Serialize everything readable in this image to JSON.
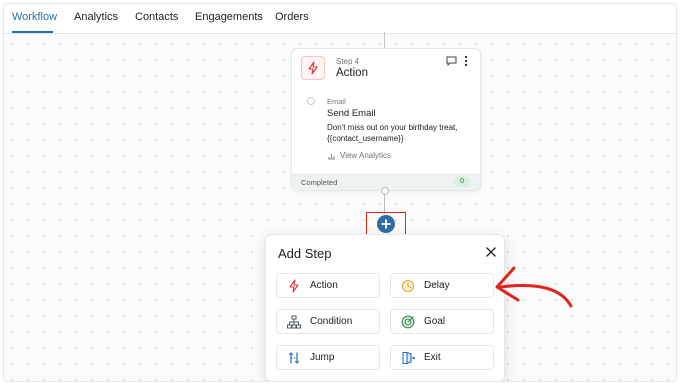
{
  "tabs": [
    {
      "label": "Workflow",
      "active": true
    },
    {
      "label": "Analytics",
      "active": false
    },
    {
      "label": "Contacts",
      "active": false
    },
    {
      "label": "Engagements",
      "active": false
    },
    {
      "label": "Orders",
      "active": false
    }
  ],
  "step_card": {
    "icon": "lightning-icon",
    "step_label": "Step 4",
    "title": "Action",
    "action_type": "Email",
    "action_name": "Send Email",
    "description": "Don't miss out on your birthday treat, {{contact_username}}",
    "analytics_link": "View Analytics",
    "footer_status": "Completed",
    "footer_count": "0"
  },
  "add_step": {
    "title": "Add Step",
    "options": [
      {
        "label": "Action",
        "icon": "lightning-icon"
      },
      {
        "label": "Delay",
        "icon": "clock-icon"
      },
      {
        "label": "Condition",
        "icon": "hierarchy-icon"
      },
      {
        "label": "Goal",
        "icon": "target-icon"
      },
      {
        "label": "Jump",
        "icon": "jump-icon"
      },
      {
        "label": "Exit",
        "icon": "exit-icon"
      }
    ]
  },
  "colors": {
    "accent": "#2271b1",
    "add_button": "#2f6e9f",
    "highlight": "#e0261c",
    "action_red": "#d63638"
  }
}
